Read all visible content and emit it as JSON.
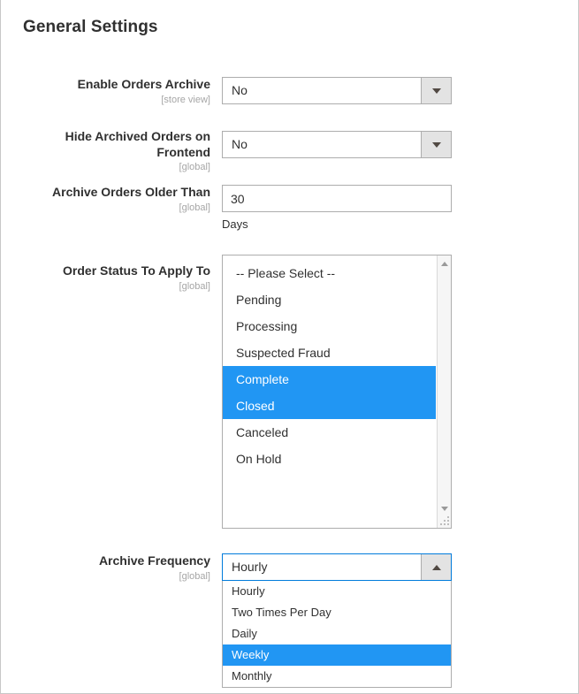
{
  "section": {
    "title": "General Settings"
  },
  "fields": {
    "enable_orders_archive": {
      "label": "Enable Orders Archive",
      "scope": "[store view]",
      "value": "No",
      "icon": "chevron-down-icon"
    },
    "hide_archived_orders": {
      "label_line1": "Hide Archived Orders on",
      "label_line2": "Frontend",
      "scope": "[global]",
      "value": "No",
      "icon": "chevron-down-icon"
    },
    "archive_orders_older_than": {
      "label": "Archive Orders Older Than",
      "scope": "[global]",
      "value": "30",
      "note": "Days"
    },
    "order_status_to_apply_to": {
      "label": "Order Status To Apply To",
      "scope": "[global]",
      "options": [
        {
          "label": "-- Please Select --",
          "selected": false
        },
        {
          "label": "Pending",
          "selected": false
        },
        {
          "label": "Processing",
          "selected": false
        },
        {
          "label": "Suspected Fraud",
          "selected": false
        },
        {
          "label": "Complete",
          "selected": true
        },
        {
          "label": "Closed",
          "selected": true
        },
        {
          "label": "Canceled",
          "selected": false
        },
        {
          "label": "On Hold",
          "selected": false
        }
      ],
      "scroll_up_icon": "scroll-up-arrow-icon",
      "scroll_down_icon": "scroll-down-arrow-icon",
      "resize_icon": "resize-grip-icon"
    },
    "archive_frequency": {
      "label": "Archive Frequency",
      "scope": "[global]",
      "value": "Hourly",
      "icon": "chevron-up-icon",
      "expanded": true,
      "options": [
        {
          "label": "Hourly",
          "highlighted": false
        },
        {
          "label": "Two Times Per Day",
          "highlighted": false
        },
        {
          "label": "Daily",
          "highlighted": false
        },
        {
          "label": "Weekly",
          "highlighted": true
        },
        {
          "label": "Monthly",
          "highlighted": false
        }
      ]
    }
  },
  "colors": {
    "highlight": "#2196f3",
    "focus_border": "#007bdb",
    "label": "#303030",
    "scope": "#a6a6a6",
    "field_border": "#adadad",
    "button_bg": "#e3e3e3"
  }
}
